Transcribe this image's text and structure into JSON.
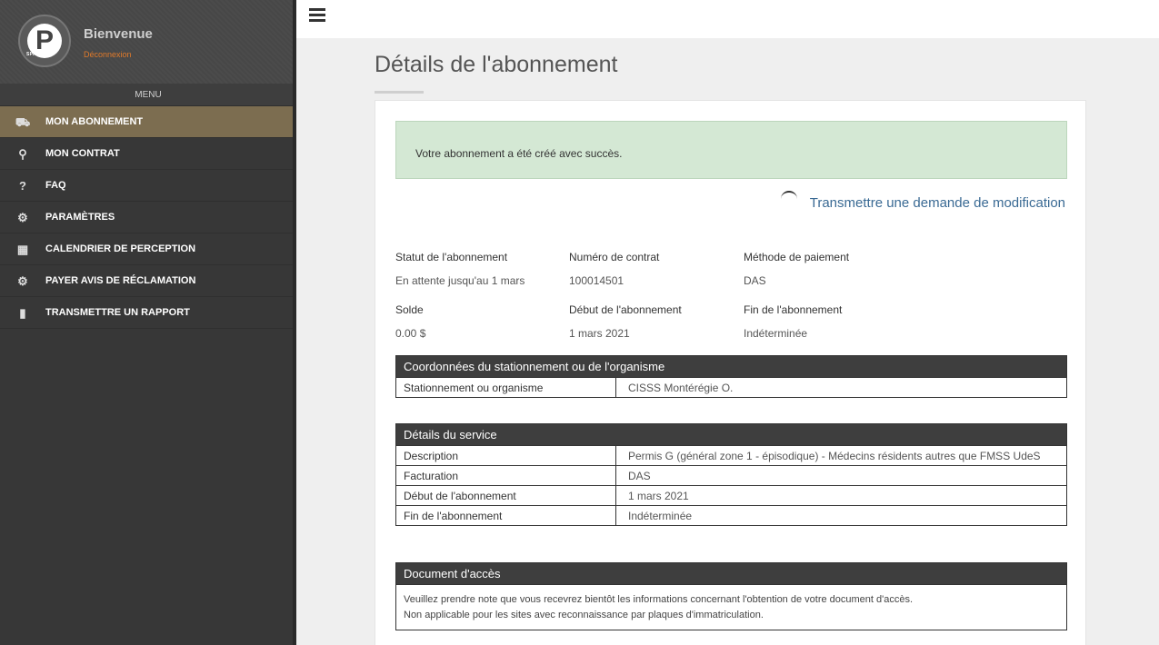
{
  "sidebar": {
    "welcome": "Bienvenue",
    "logout": "Déconnexion",
    "logo_text": "SPAG",
    "menu_label": "MENU",
    "items": [
      {
        "label": "MON ABONNEMENT",
        "icon": "car-icon",
        "glyph": "🚗"
      },
      {
        "label": "MON CONTRAT",
        "icon": "search-icon",
        "glyph": "🔍"
      },
      {
        "label": "FAQ",
        "icon": "question-icon",
        "glyph": "?"
      },
      {
        "label": "PARAMÈTRES",
        "icon": "gear-icon",
        "glyph": "⚙"
      },
      {
        "label": "CALENDRIER DE PERCEPTION",
        "icon": "calendar-icon",
        "glyph": "▦"
      },
      {
        "label": "PAYER AVIS DE RÉCLAMATION",
        "icon": "gear-icon",
        "glyph": "⚙"
      },
      {
        "label": "TRANSMETTRE UN RAPPORT",
        "icon": "file-icon",
        "glyph": "▮"
      }
    ]
  },
  "page": {
    "title": "Détails de l'abonnement",
    "alert": "Votre abonnement a été créé avec succès.",
    "modify_link": "Transmettre une demande de modification"
  },
  "summary": {
    "status_label": "Statut de l'abonnement",
    "status_value": "En attente jusqu'au 1 mars",
    "contract_label": "Numéro de contrat",
    "contract_value": "100014501",
    "payment_label": "Méthode de paiement",
    "payment_value": "DAS",
    "balance_label": "Solde",
    "balance_value": "0.00 $",
    "start_label": "Début de l'abonnement",
    "start_value": "1 mars 2021",
    "end_label": "Fin de l'abonnement",
    "end_value": "Indéterminée"
  },
  "location": {
    "title": "Coordonnées du stationnement ou de l'organisme",
    "rows": [
      {
        "k": "Stationnement ou organisme",
        "v": "CISSS Montérégie O."
      }
    ]
  },
  "service": {
    "title": "Détails du service",
    "rows": [
      {
        "k": "Description",
        "v": "Permis G (général zone 1 - épisodique) - Médecins résidents autres que FMSS UdeS"
      },
      {
        "k": "Facturation",
        "v": "DAS"
      },
      {
        "k": "Début de l'abonnement",
        "v": "1 mars 2021"
      },
      {
        "k": "Fin de l'abonnement",
        "v": "Indéterminée"
      }
    ]
  },
  "access": {
    "title": "Document d'accès",
    "line1": "Veuillez prendre note que vous recevrez bientôt les informations concernant l'obtention de votre document d'accès.",
    "line2": "Non applicable pour les sites avec reconnaissance par plaques d'immatriculation."
  }
}
